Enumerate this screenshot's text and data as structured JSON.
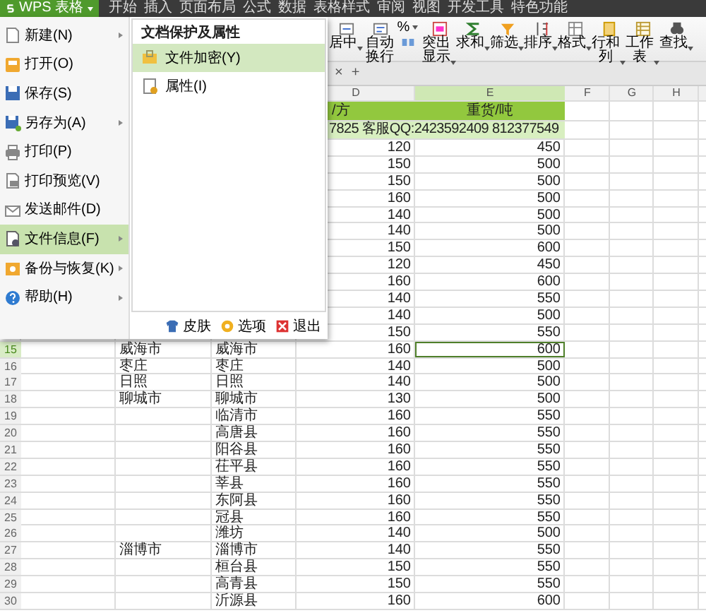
{
  "app_button": {
    "label": "WPS 表格"
  },
  "menu_tabs": [
    {
      "label": "开始"
    },
    {
      "label": "插入"
    },
    {
      "label": "页面布局"
    },
    {
      "label": "公式"
    },
    {
      "label": "数据"
    },
    {
      "label": "表格样式"
    },
    {
      "label": "审阅"
    },
    {
      "label": "视图"
    },
    {
      "label": "开发工具"
    },
    {
      "label": "特色功能"
    }
  ],
  "ribbon": [
    {
      "kind": "button",
      "label": "居中",
      "dropdown": true
    },
    {
      "kind": "button",
      "label": "自动换行",
      "dropdown": false
    },
    {
      "kind": "number",
      "label": "%",
      "dropdown": true
    },
    {
      "kind": "button",
      "label": "突出显示",
      "dropdown": true
    },
    {
      "kind": "button",
      "label": "求和",
      "dropdown": true
    },
    {
      "kind": "button",
      "label": "筛选",
      "dropdown": true
    },
    {
      "kind": "button",
      "label": "排序",
      "dropdown": true
    },
    {
      "kind": "button",
      "label": "格式",
      "dropdown": true
    },
    {
      "kind": "button",
      "label": "行和列",
      "dropdown": true
    },
    {
      "kind": "button",
      "label": "工作表",
      "dropdown": true
    },
    {
      "kind": "button",
      "label": "查找",
      "dropdown": true
    }
  ],
  "tab_strip": {
    "close": "×",
    "add": "+"
  },
  "columns": [
    {
      "label": "D",
      "selected": false
    },
    {
      "label": "E",
      "selected": true
    },
    {
      "label": "F",
      "selected": false
    },
    {
      "label": "G",
      "selected": false
    },
    {
      "label": "H",
      "selected": false
    }
  ],
  "title_row": {
    "column_d": "/方",
    "column_e": "重货/吨"
  },
  "contact_row": {
    "text": "7825 客服QQ:2423592409 812377549"
  },
  "rows": [
    {
      "selected": false,
      "column_d": "120",
      "column_e": "450"
    },
    {
      "selected": false,
      "column_d": "150",
      "column_e": "500"
    },
    {
      "selected": false,
      "column_d": "150",
      "column_e": "500"
    },
    {
      "selected": false,
      "column_d": "160",
      "column_e": "500"
    },
    {
      "selected": false,
      "column_d": "140",
      "column_e": "500"
    },
    {
      "selected": false,
      "column_d": "140",
      "column_e": "500"
    },
    {
      "selected": false,
      "column_d": "150",
      "column_e": "600"
    },
    {
      "selected": false,
      "column_d": "120",
      "column_e": "450"
    },
    {
      "selected": false,
      "column_d": "160",
      "column_e": "600"
    },
    {
      "selected": false,
      "column_d": "140",
      "column_e": "550"
    },
    {
      "selected": false,
      "column_d": "140",
      "column_e": "500"
    },
    {
      "selected": false,
      "column_d": "150",
      "column_e": "550"
    },
    {
      "number": "15",
      "selected": true,
      "column_b": "威海市",
      "column_c": "威海市",
      "column_d": "160",
      "column_e": "600"
    },
    {
      "number": "16",
      "selected": false,
      "column_b": "枣庄",
      "column_c": "枣庄",
      "column_d": "140",
      "column_e": "500"
    },
    {
      "number": "17",
      "selected": false,
      "column_b": "日照",
      "column_c": "日照",
      "column_d": "140",
      "column_e": "500"
    },
    {
      "number": "18",
      "selected": false,
      "column_b": "聊城市",
      "column_c": "聊城市",
      "column_d": "130",
      "column_e": "500"
    },
    {
      "number": "19",
      "selected": false,
      "column_c": "临清市",
      "column_d": "160",
      "column_e": "550"
    },
    {
      "number": "20",
      "selected": false,
      "column_c": "高唐县",
      "column_d": "160",
      "column_e": "550"
    },
    {
      "number": "21",
      "selected": false,
      "column_c": "阳谷县",
      "column_d": "160",
      "column_e": "550"
    },
    {
      "number": "22",
      "selected": false,
      "column_c": "茌平县",
      "column_d": "160",
      "column_e": "550"
    },
    {
      "number": "23",
      "selected": false,
      "column_c": "莘县",
      "column_d": "160",
      "column_e": "550"
    },
    {
      "number": "24",
      "selected": false,
      "column_c": "东阿县",
      "column_d": "160",
      "column_e": "550"
    },
    {
      "number": "25",
      "selected": false,
      "column_c": "冠县",
      "column_d": "160",
      "column_e": "550"
    },
    {
      "number": "26",
      "selected": false,
      "column_c": "潍坊",
      "column_d": "140",
      "column_e": "500"
    },
    {
      "number": "27",
      "selected": false,
      "column_b": "淄博市",
      "column_c": "淄博市",
      "column_d": "140",
      "column_e": "550"
    },
    {
      "number": "28",
      "selected": false,
      "column_c": "桓台县",
      "column_d": "150",
      "column_e": "550"
    },
    {
      "number": "29",
      "selected": false,
      "column_c": "高青县",
      "column_d": "150",
      "column_e": "550"
    },
    {
      "number": "30",
      "selected": false,
      "column_c": "沂源县",
      "column_d": "160",
      "column_e": "600"
    }
  ],
  "file_menu": {
    "items": [
      {
        "label": "新建(N)",
        "submenu": true,
        "selected": false
      },
      {
        "label": "打开(O)",
        "submenu": false,
        "selected": false
      },
      {
        "label": "保存(S)",
        "submenu": false,
        "selected": false
      },
      {
        "label": "另存为(A)",
        "submenu": true,
        "selected": false
      },
      {
        "label": "打印(P)",
        "submenu": false,
        "selected": false
      },
      {
        "label": "打印预览(V)",
        "submenu": false,
        "selected": false
      },
      {
        "label": "发送邮件(D)",
        "submenu": false,
        "selected": false
      },
      {
        "label": "文件信息(F)",
        "submenu": true,
        "selected": true
      },
      {
        "label": "备份与恢复(K)",
        "submenu": true,
        "selected": false
      },
      {
        "label": "帮助(H)",
        "submenu": true,
        "selected": false
      }
    ],
    "submenu": {
      "title": "文档保护及属性",
      "items": [
        {
          "label": "文件加密(Y)",
          "selected": true
        },
        {
          "label": "属性(I)",
          "selected": false
        }
      ]
    },
    "footer": [
      {
        "label": "皮肤"
      },
      {
        "label": "选项"
      },
      {
        "label": "退出"
      }
    ]
  }
}
